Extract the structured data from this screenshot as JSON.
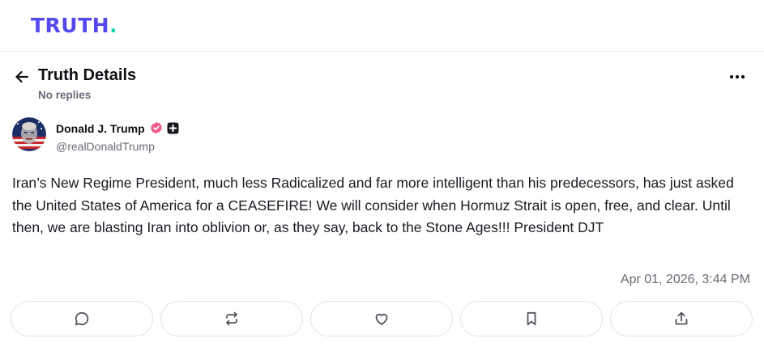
{
  "brand": {
    "logo_text": "TRUTH",
    "logo_dot": ".",
    "logo_color": "#5448ee",
    "dot_color": "#19d3b7"
  },
  "header": {
    "title": "Truth Details",
    "subtitle": "No replies",
    "back_icon": "arrow-left-icon",
    "more_icon": "more-horizontal-icon"
  },
  "post": {
    "author": {
      "display_name": "Donald J. Trump",
      "handle": "@realDonaldTrump",
      "verified_badge_icon": "verified-badge-icon",
      "verified_color": "#ee5a8a",
      "plus_badge_icon": "plus-badge-icon"
    },
    "text": "Iran’s New Regime President, much less Radicalized and far more intelligent than his predecessors, has just asked the United States of America for a CEASEFIRE! We will consider when Hormuz Strait is open, free, and clear. Until then, we are blasting Iran into oblivion or, as they say, back to the Stone Ages!!! President DJT",
    "timestamp": "Apr 01, 2026, 3:44 PM"
  },
  "actions": [
    {
      "name": "reply-button",
      "icon": "comment-icon"
    },
    {
      "name": "retruth-button",
      "icon": "repost-icon"
    },
    {
      "name": "like-button",
      "icon": "heart-icon"
    },
    {
      "name": "bookmark-button",
      "icon": "bookmark-icon"
    },
    {
      "name": "share-button",
      "icon": "share-icon"
    }
  ]
}
